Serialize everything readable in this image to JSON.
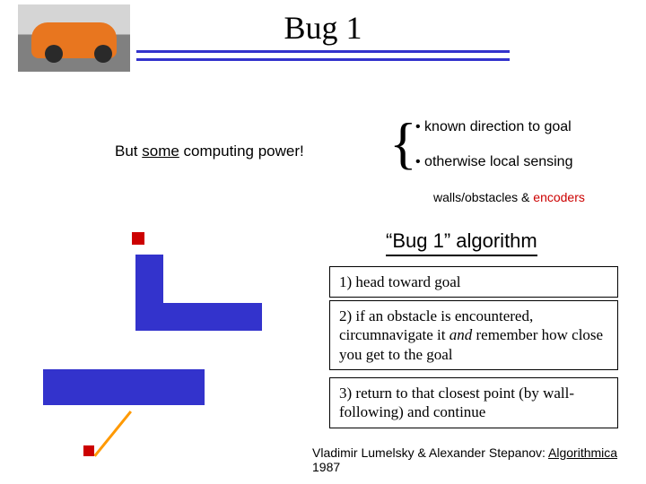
{
  "title": "Bug 1",
  "subtitle_pre": "But ",
  "subtitle_u": "some",
  "subtitle_post": " computing power!",
  "bullet1": "• known direction to goal",
  "bullet2": "• otherwise local sensing",
  "walls_pre": "walls/obstacles  &  ",
  "walls_enc": "encoders",
  "algo_title": "“Bug 1” algorithm",
  "step1": "1) head toward goal",
  "step2_a": "2) if an obstacle is encountered, circumnavigate it ",
  "step2_it": "and",
  "step2_b": " remember how close you get to the goal",
  "step3": "3) return to that closest point (by wall-following) and continue",
  "cite_pre": "Vladimir Lumelsky & Alexander Stepanov:  ",
  "cite_u": "Algorithmica",
  "cite_post": " 1987"
}
